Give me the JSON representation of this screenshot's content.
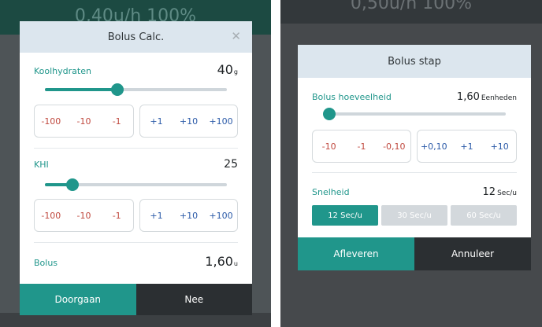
{
  "colors": {
    "accent": "#20968b",
    "negative": "#c0493f",
    "positive": "#2b5aa8",
    "dark_button": "#2b2f32",
    "header_bg": "#dce6ee"
  },
  "left": {
    "background_value": "0,40u/h 100%",
    "dialog": {
      "title": "Bolus Calc.",
      "close_icon": "close-icon",
      "carbs": {
        "label": "Koolhydraten",
        "value": "40",
        "unit": "g",
        "slider_fraction": 0.4
      },
      "carb_step_neg": [
        "-100",
        "-10",
        "-1"
      ],
      "carb_step_pos": [
        "+1",
        "+10",
        "+100"
      ],
      "khi": {
        "label": "KHI",
        "value": "25",
        "slider_fraction": 0.15
      },
      "khi_step_neg": [
        "-100",
        "-10",
        "-1"
      ],
      "khi_step_pos": [
        "+1",
        "+10",
        "+100"
      ],
      "bolus": {
        "label": "Bolus",
        "value": "1,60",
        "unit": "u"
      },
      "primary_label": "Doorgaan",
      "secondary_label": "Nee"
    }
  },
  "right": {
    "background_value": "0,50u/h 100%",
    "dialog": {
      "title": "Bolus stap",
      "amount": {
        "label": "Bolus hoeveelheid",
        "value": "1,60",
        "unit": "Eenheden",
        "slider_fraction": 0.0
      },
      "step_neg": [
        "-10",
        "-1",
        "-0,10"
      ],
      "step_pos": [
        "+0,10",
        "+1",
        "+10"
      ],
      "speed": {
        "label": "Snelheid",
        "value": "12",
        "unit": "Sec/u",
        "options": [
          "12 Sec/u",
          "30 Sec/u",
          "60 Sec/u"
        ],
        "selected": "12 Sec/u"
      },
      "primary_label": "Afleveren",
      "secondary_label": "Annuleer"
    }
  }
}
